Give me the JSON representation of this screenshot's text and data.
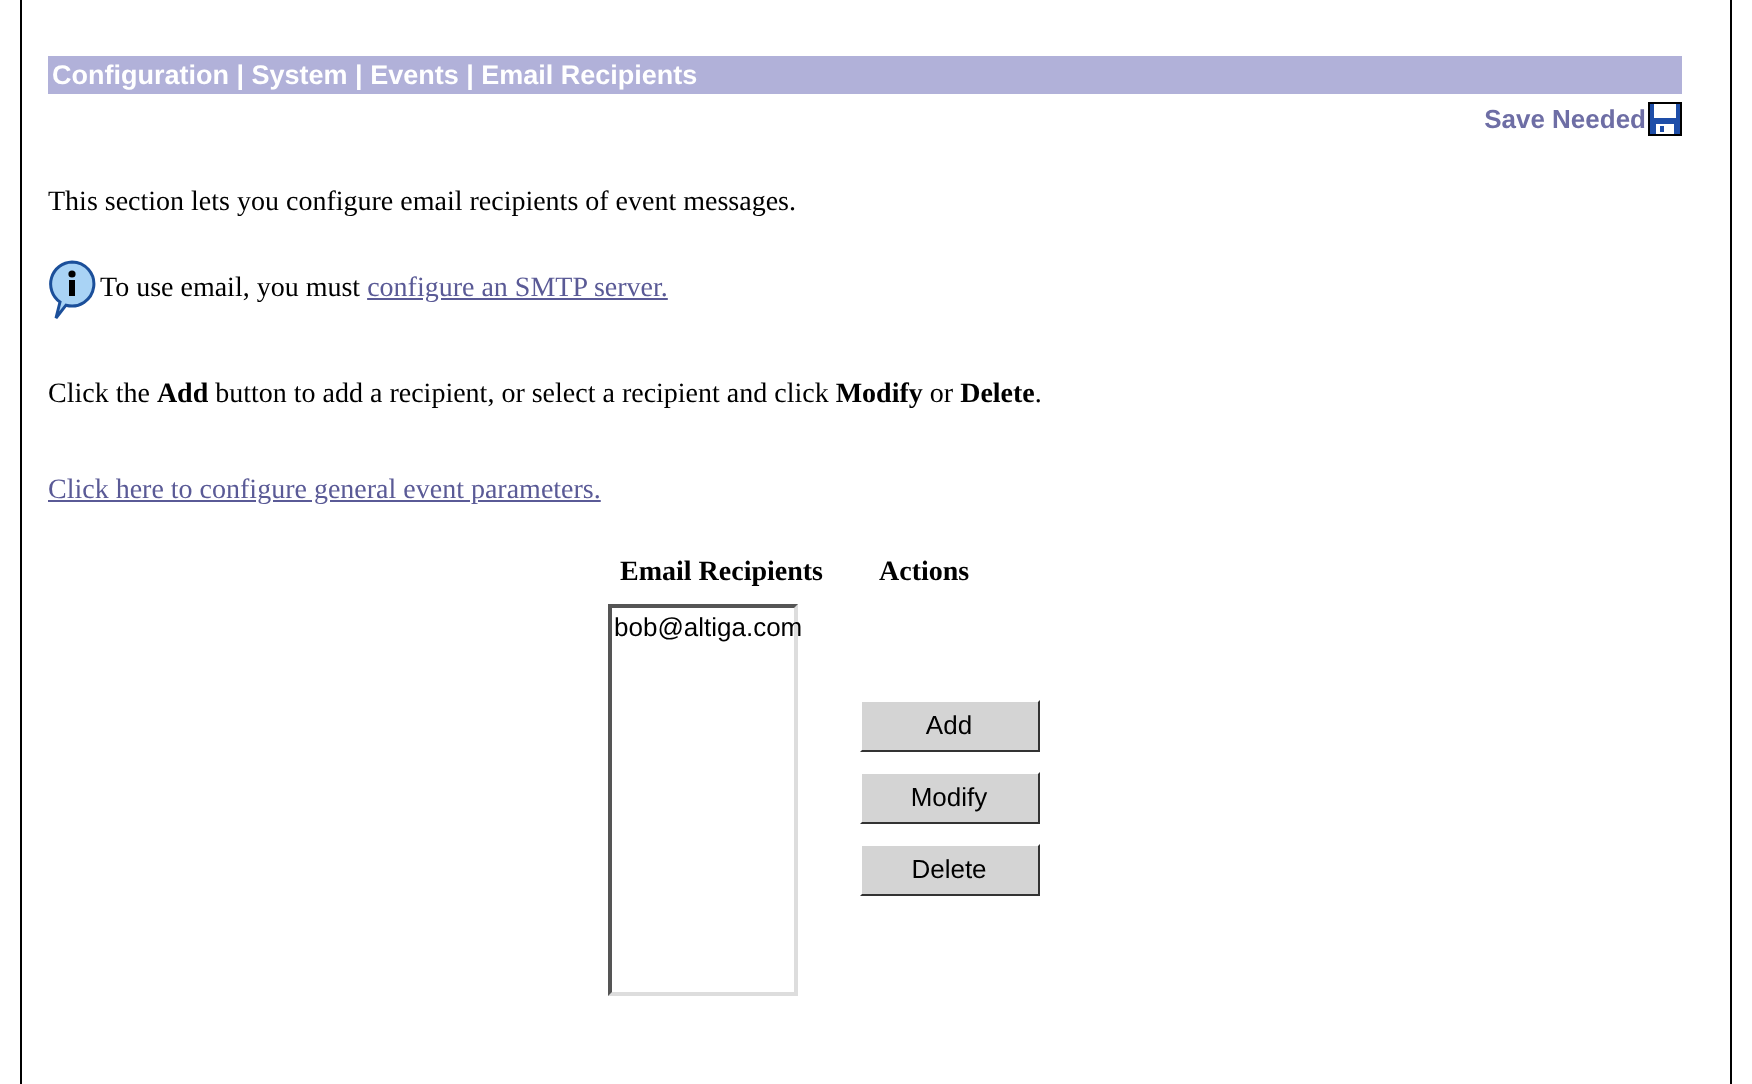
{
  "breadcrumb": "Configuration | System | Events | Email Recipients",
  "save_status": "Save Needed",
  "intro": "This section lets you configure email recipients of event messages.",
  "notice": {
    "text": "To use email, you must",
    "link": "configure an SMTP server."
  },
  "instructions": "Click the **Add** button to add a recipient, or select a recipient and click **Modify** or **Delete**.",
  "general_link": "Click here to configure general event parameters.",
  "recipients": {
    "heading": "Email Recipients",
    "items": [
      {
        "label": "bob@altiga.com",
        "selected": false
      }
    ]
  },
  "actions": {
    "heading": "Actions",
    "buttons": [
      "Add",
      "Modify",
      "Delete"
    ]
  }
}
